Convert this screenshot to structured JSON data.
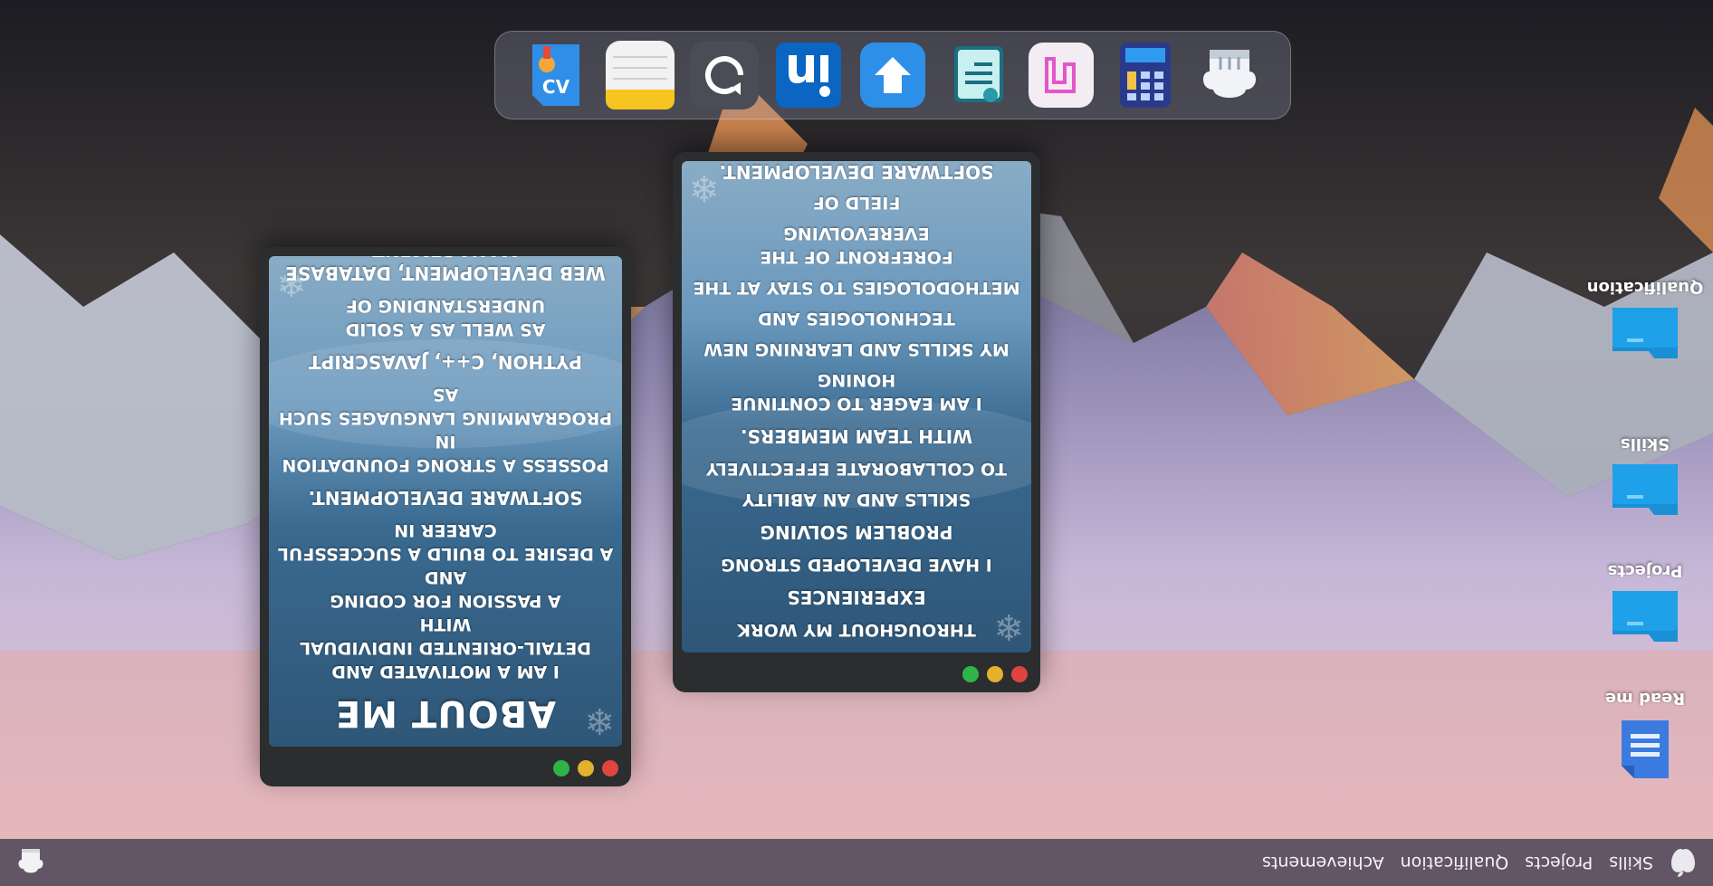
{
  "menubar": {
    "items": [
      "Skills",
      "Projects",
      "Qualification",
      "Achievements"
    ]
  },
  "desktop_icons": [
    {
      "label": "Qualification",
      "icon": "folder-icon"
    },
    {
      "label": "Skills",
      "icon": "folder-icon"
    },
    {
      "label": "Projects",
      "icon": "folder-icon"
    },
    {
      "label": "Read me",
      "icon": "document-icon"
    }
  ],
  "about_window": {
    "title": "ABOUT ME",
    "lines": [
      "I am a motivated and",
      "detail-oriented individual with",
      "a passion for coding",
      "and",
      "a desire to build a successful",
      "career in",
      "software development.",
      "possess a strong foundation in",
      "programming languages such as",
      "Python,  C++, JavaScript",
      "as well as a solid",
      "understanding of",
      "web development, database",
      "management"
    ]
  },
  "experience_window": {
    "lines": [
      "Throughout my work",
      "experiences",
      "I have developed strong",
      "problem solving",
      "skills and an ability",
      "to collaborate effectively",
      "with team members.",
      "I am eager to continue honing",
      "my skills and learning new",
      "technologies and",
      "methodologies to stay at the",
      "forefront of the everevolving",
      "field of",
      "software development."
    ]
  },
  "dock": {
    "apps": [
      {
        "name": "cv-app-icon"
      },
      {
        "name": "notes-app-icon"
      },
      {
        "name": "refresh-app-icon"
      },
      {
        "name": "linkedin-app-icon"
      },
      {
        "name": "download-app-icon"
      },
      {
        "name": "certificate-app-icon"
      },
      {
        "name": "music-app-icon"
      },
      {
        "name": "calculator-app-icon"
      },
      {
        "name": "chef-hat-app-icon"
      }
    ]
  },
  "colors": {
    "menubar": "#3c3a4e",
    "window_frame": "#2b2d2f",
    "folder": "#1ea1e8",
    "document": "#3b7be0"
  }
}
